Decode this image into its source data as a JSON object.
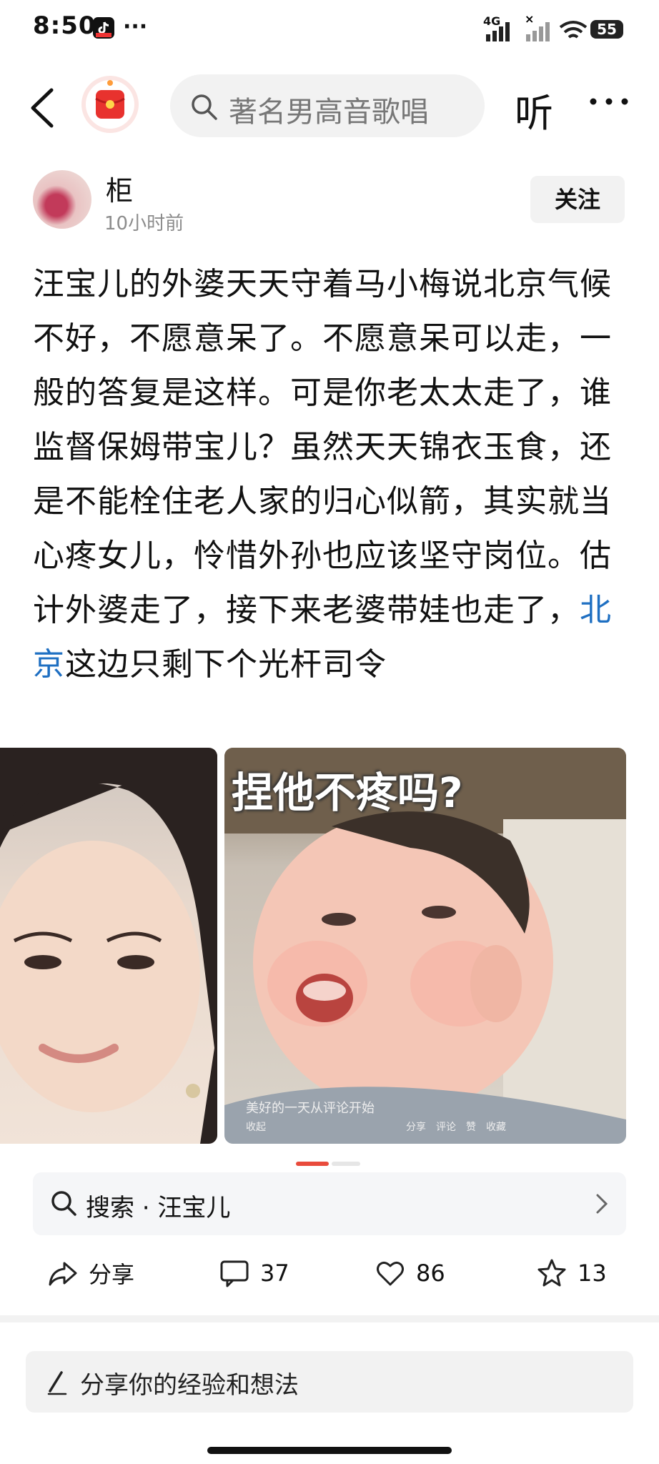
{
  "status_bar": {
    "time": "8:50",
    "more": "···",
    "network": "4G",
    "battery": "55"
  },
  "search": {
    "placeholder": "著名男高音歌唱"
  },
  "nav": {
    "listen_label": "听"
  },
  "author": {
    "name": "柜",
    "post_time": "10小时前",
    "follow_label": "关注"
  },
  "post": {
    "text_before_link": "汪宝儿的外婆天天守着马小梅说北京气候不好，不愿意呆了。不愿意呆可以走，一般的答复是这样。可是你老太太走了，谁监督保姆带宝儿？虽然天天锦衣玉食，还是不能栓住老人家的归心似箭，其实就当心疼女儿，怜惜外孙也应该坚守岗位。估计外婆走了，接下来老婆带娃也走了，",
    "link_text": "北京",
    "text_after_link": "这边只剩下个光杆司令"
  },
  "images": {
    "baby_caption": "捏他不疼吗?",
    "baby_subtitle": "美好的一天从评论开始",
    "baby_toolbar": "收起　　　　　　　　　　　　　　分享　评论　赞　收藏"
  },
  "search_suggest": {
    "label": "搜索 · 汪宝儿"
  },
  "actions": {
    "share": "分享",
    "comments": "37",
    "likes": "86",
    "favorites": "13"
  },
  "comment_input": {
    "placeholder": "分享你的经验和想法"
  },
  "colors": {
    "link": "#1e6fc2",
    "accent": "#e94b3c"
  }
}
